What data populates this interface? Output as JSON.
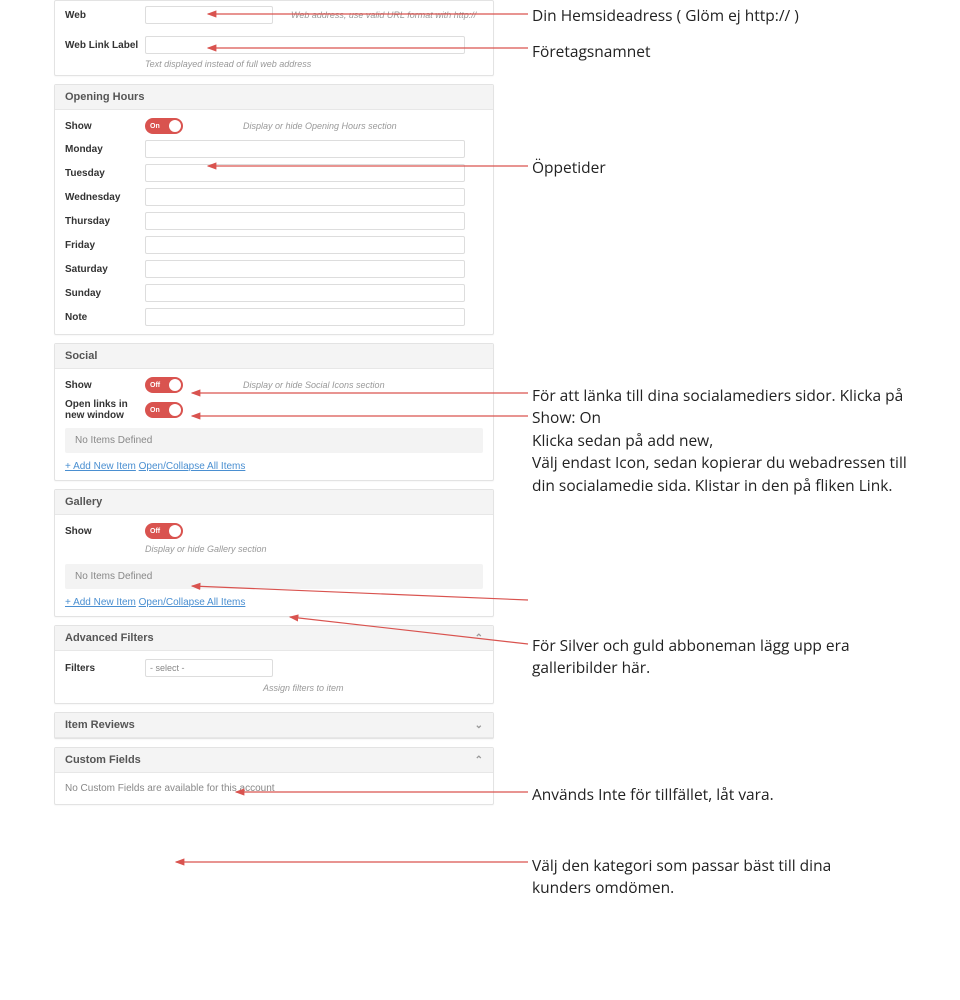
{
  "form": {
    "web_label": "Web",
    "web_help": "Web address, use valid URL format with http://",
    "weblink_label": "Web Link Label",
    "weblink_help": "Text displayed instead of full web address",
    "opening_header": "Opening Hours",
    "show_label": "Show",
    "toggle_on": "On",
    "toggle_off": "Off",
    "opening_help": "Display or hide Opening Hours section",
    "days": {
      "mon": "Monday",
      "tue": "Tuesday",
      "wed": "Wednesday",
      "thu": "Thursday",
      "fri": "Friday",
      "sat": "Saturday",
      "sun": "Sunday",
      "note": "Note"
    },
    "social_header": "Social",
    "social_help": "Display or hide Social Icons section",
    "open_links_label": "Open links in new window",
    "no_items": "No Items Defined",
    "add_new": "+ Add New Item",
    "open_collapse": "Open/Collapse All Items",
    "gallery_header": "Gallery",
    "gallery_help": "Display or hide Gallery section",
    "adv_filters_header": "Advanced Filters",
    "filters_label": "Filters",
    "filters_select": "- select -",
    "filters_help": "Assign filters to item",
    "item_reviews_header": "Item Reviews",
    "custom_fields_header": "Custom Fields",
    "custom_fields_text": "No Custom Fields are available for this account"
  },
  "annotations": {
    "a1": "Din Hemsideadress ( Glöm ej http:// )",
    "a2": "Företagsnamnet",
    "a3": "Öppetider",
    "a4": "För att länka till dina socialamediers sidor. Klicka på Show: On\nKlicka sedan på add new,\nVälj endast Icon, sedan kopierar du webadressen till din socialamedie sida. Klistar in den på fliken Link.",
    "a5": "För Silver och guld abboneman lägg upp era galleribilder här.",
    "a6": "Används Inte för tillfället, låt vara.",
    "a7": "Välj den kategori som passar bäst till dina kunders omdömen."
  }
}
